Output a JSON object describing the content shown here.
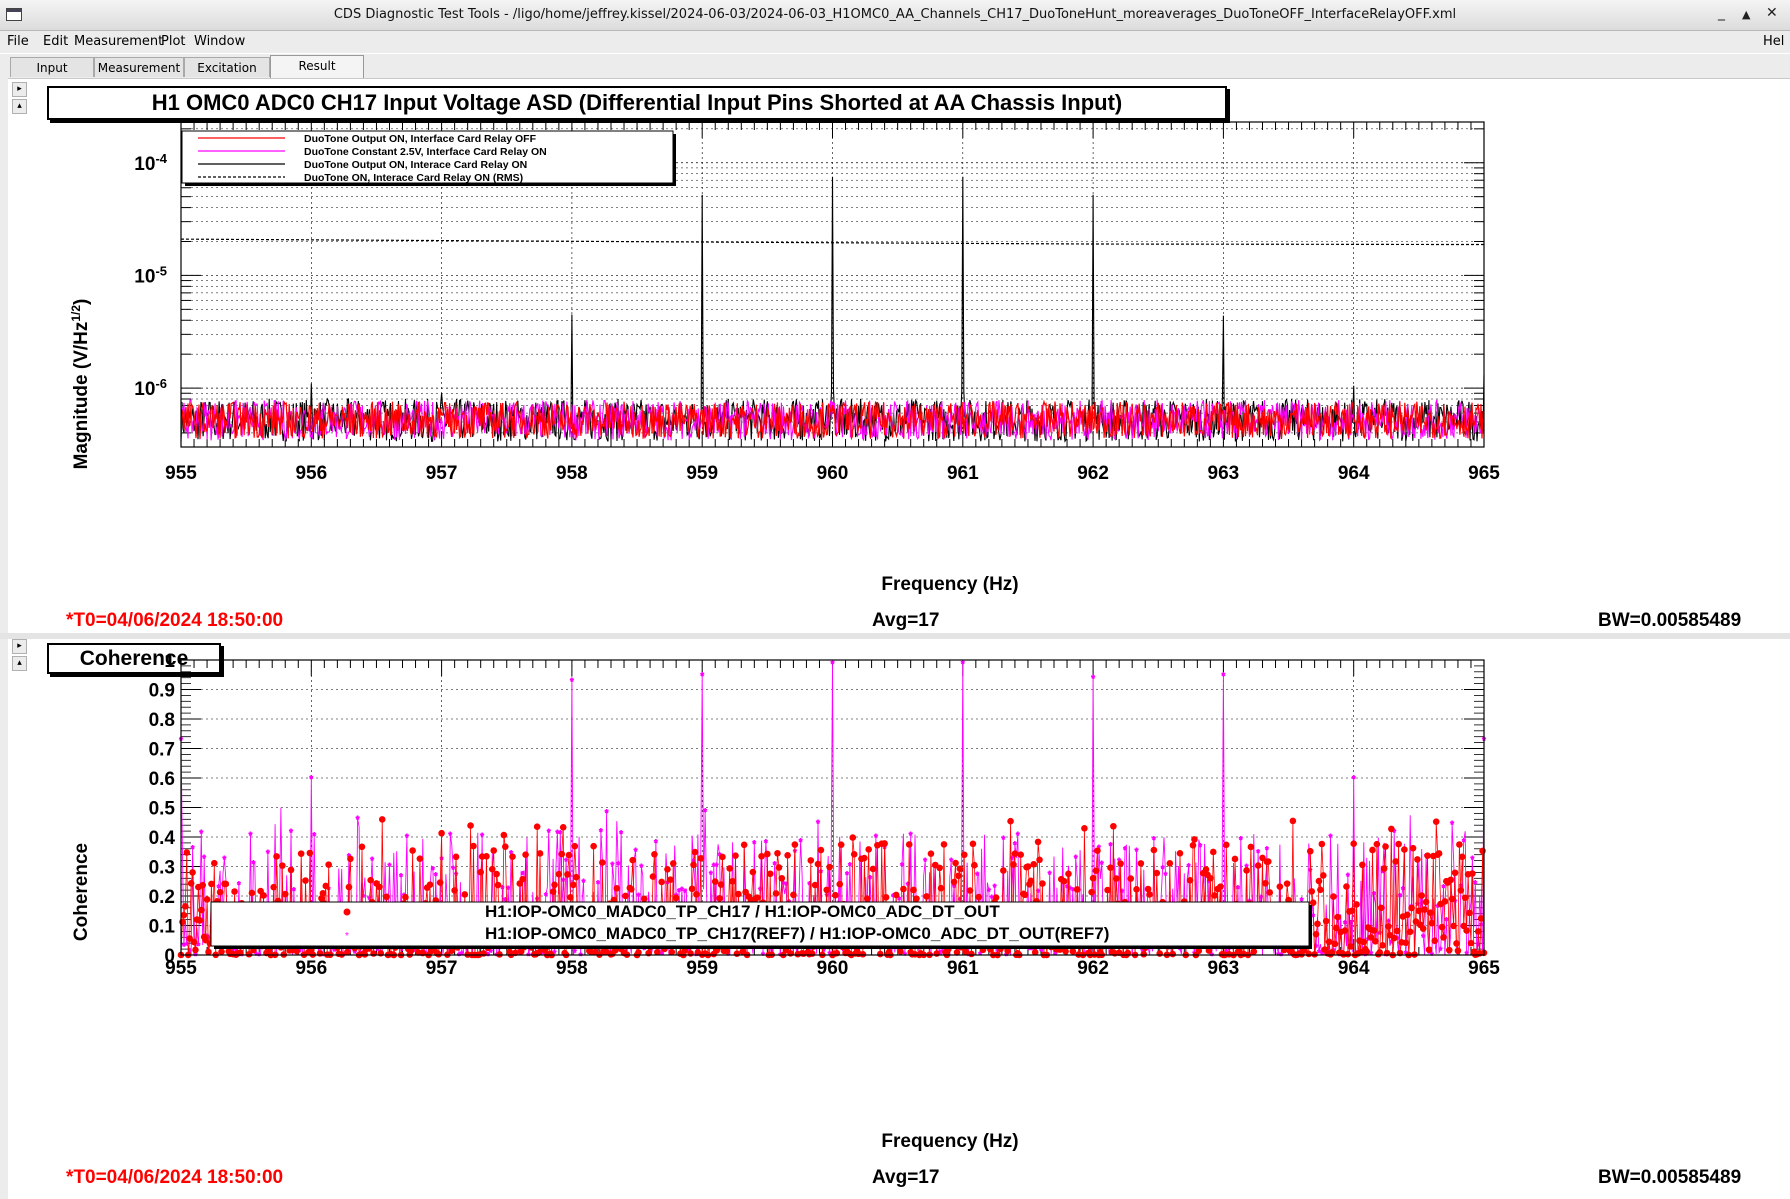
{
  "window": {
    "title": "CDS Diagnostic Test Tools - /ligo/home/jeffrey.kissel/2024-06-03/2024-06-03_H1OMC0_AA_Channels_CH17_DuoToneHunt_moreaverages_DuoToneOFF_InterfaceRelayOFF.xml",
    "btn_min": "_",
    "btn_max": "▲",
    "btn_close": "✕"
  },
  "menu": [
    "File",
    "Edit",
    "Measurement",
    "Plot",
    "Window"
  ],
  "menu_help": "Hel",
  "tabs": [
    "Input",
    "Measurement",
    "Excitation",
    "Result"
  ],
  "active_tab": "Result",
  "panel1": {
    "title": "H1 OMC0 ADC0 CH17 Input Voltage ASD (Differential Input Pins Shorted at AA Chassis Input)",
    "t0": "*T0=04/06/2024 18:50:00",
    "avg": "Avg=17",
    "bw": "BW=0.00585489"
  },
  "panel2": {
    "title": "Coherence",
    "t0": "*T0=04/06/2024 18:50:00",
    "avg": "Avg=17",
    "bw": "BW=0.00585489"
  },
  "colors": {
    "red": "#ff0000",
    "magenta": "#ff00ff",
    "black": "#000000",
    "t0": "#ff0000"
  },
  "chart_data": [
    {
      "type": "line",
      "title": "H1 OMC0 ADC0 CH17 Input Voltage ASD (Differential Input Pins Shorted at AA Chassis Input)",
      "xlabel": "Frequency (Hz)",
      "ylabel": "Magnitude (V/Hz^(1/2))",
      "xlim": [
        955,
        965
      ],
      "ylim": [
        3e-07,
        0.00023
      ],
      "yscale": "log",
      "grid": true,
      "legend_position": "top-left",
      "x_ticks": [
        "955",
        "956",
        "957",
        "958",
        "959",
        "960",
        "961",
        "962",
        "963",
        "964",
        "965"
      ],
      "y_ticks": [
        "10^-6",
        "10^-5",
        "10^-4"
      ],
      "noise_floor": 5.2e-07,
      "series": [
        {
          "name": "DuoTone Output ON, Interface Card Relay OFF",
          "color": "#ff0000",
          "style": "solid"
        },
        {
          "name": "DuoTone Constant 2.5V, Interface Card Relay ON",
          "color": "#ff00ff",
          "style": "solid"
        },
        {
          "name": "DuoTone Output ON, Interace Card Relay ON",
          "color": "#000000",
          "style": "solid",
          "peaks": [
            {
              "x": 956,
              "y": 1.1e-06
            },
            {
              "x": 957,
              "y": 9e-07
            },
            {
              "x": 958,
              "y": 4.5e-06
            },
            {
              "x": 959,
              "y": 5.2e-05
            },
            {
              "x": 960,
              "y": 7.5e-05
            },
            {
              "x": 961,
              "y": 7.5e-05
            },
            {
              "x": 962,
              "y": 5.2e-05
            },
            {
              "x": 963,
              "y": 4.4e-06
            },
            {
              "x": 964,
              "y": 1.05e-06
            },
            {
              "x": 965,
              "y": 1.3e-06
            }
          ]
        },
        {
          "name": "DuoTone ON, Interace Card Relay ON (RMS)",
          "color": "#000000",
          "style": "dashed",
          "x": [
            955,
            960,
            962,
            965
          ],
          "y": [
            2.1e-05,
            1.95e-05,
            1.9e-05,
            1.88e-05
          ]
        }
      ]
    },
    {
      "type": "scatter",
      "title": "Coherence",
      "xlabel": "Frequency (Hz)",
      "ylabel": "Coherence",
      "xlim": [
        955,
        965
      ],
      "ylim": [
        0,
        1
      ],
      "grid": true,
      "legend_position": "bottom-center",
      "x_ticks": [
        "955",
        "956",
        "957",
        "958",
        "959",
        "960",
        "961",
        "962",
        "963",
        "964",
        "965"
      ],
      "y_ticks": [
        "0",
        "0.1",
        "0.2",
        "0.3",
        "0.4",
        "0.5",
        "0.6",
        "0.7",
        "0.8",
        "0.9",
        "1"
      ],
      "series": [
        {
          "name": "H1:IOP-OMC0_MADC0_TP_CH17 / H1:IOP-OMC0_ADC_DT_OUT",
          "color": "#ff0000",
          "marker": "dot"
        },
        {
          "name": "H1:IOP-OMC0_MADC0_TP_CH17(REF7) / H1:IOP-OMC0_ADC_DT_OUT(REF7)",
          "color": "#ff00ff",
          "marker": "star",
          "peaks": [
            {
              "x": 955,
              "y": 0.73
            },
            {
              "x": 956,
              "y": 0.6
            },
            {
              "x": 958,
              "y": 0.93
            },
            {
              "x": 959,
              "y": 0.95
            },
            {
              "x": 960,
              "y": 0.99
            },
            {
              "x": 961,
              "y": 0.99
            },
            {
              "x": 962,
              "y": 0.94
            },
            {
              "x": 963,
              "y": 0.95
            },
            {
              "x": 964,
              "y": 0.6
            },
            {
              "x": 965,
              "y": 0.73
            }
          ]
        }
      ]
    }
  ]
}
